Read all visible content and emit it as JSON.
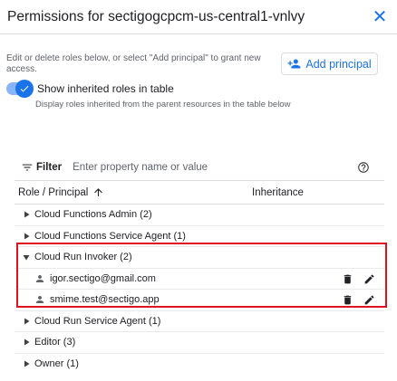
{
  "dialog": {
    "title": "Permissions for sectigogcpcm-us-central1-vnlvy",
    "close_icon": "close-icon"
  },
  "intro": {
    "description": "Edit or delete roles below, or select \"Add principal\" to grant new access.",
    "add_principal_label": "Add principal",
    "add_principal_icon": "person-add-icon"
  },
  "inherited_toggle": {
    "label": "Show inherited roles in table",
    "sublabel": "Display roles inherited from the parent resources in the table below",
    "checked": true
  },
  "filter": {
    "label": "Filter",
    "placeholder": "Enter property name or value"
  },
  "columns": {
    "role": "Role / Principal",
    "inheritance": "Inheritance",
    "sort_icon": "arrow-up-icon"
  },
  "rows": [
    {
      "label": "Cloud Functions Admin (2)",
      "expanded": false
    },
    {
      "label": "Cloud Functions Service Agent (1)",
      "expanded": false
    },
    {
      "label": "Cloud Run Invoker (2)",
      "expanded": true
    },
    {
      "label": "igor.sectigo@gmail.com"
    },
    {
      "label": "smime.test@sectigo.app"
    },
    {
      "label": "Cloud Run Service Agent (1)",
      "expanded": false
    },
    {
      "label": "Editor (3)",
      "expanded": false
    },
    {
      "label": "Owner (1)",
      "expanded": false
    }
  ],
  "colors": {
    "accent": "#1a73e8",
    "highlight_border": "#e0121f"
  }
}
